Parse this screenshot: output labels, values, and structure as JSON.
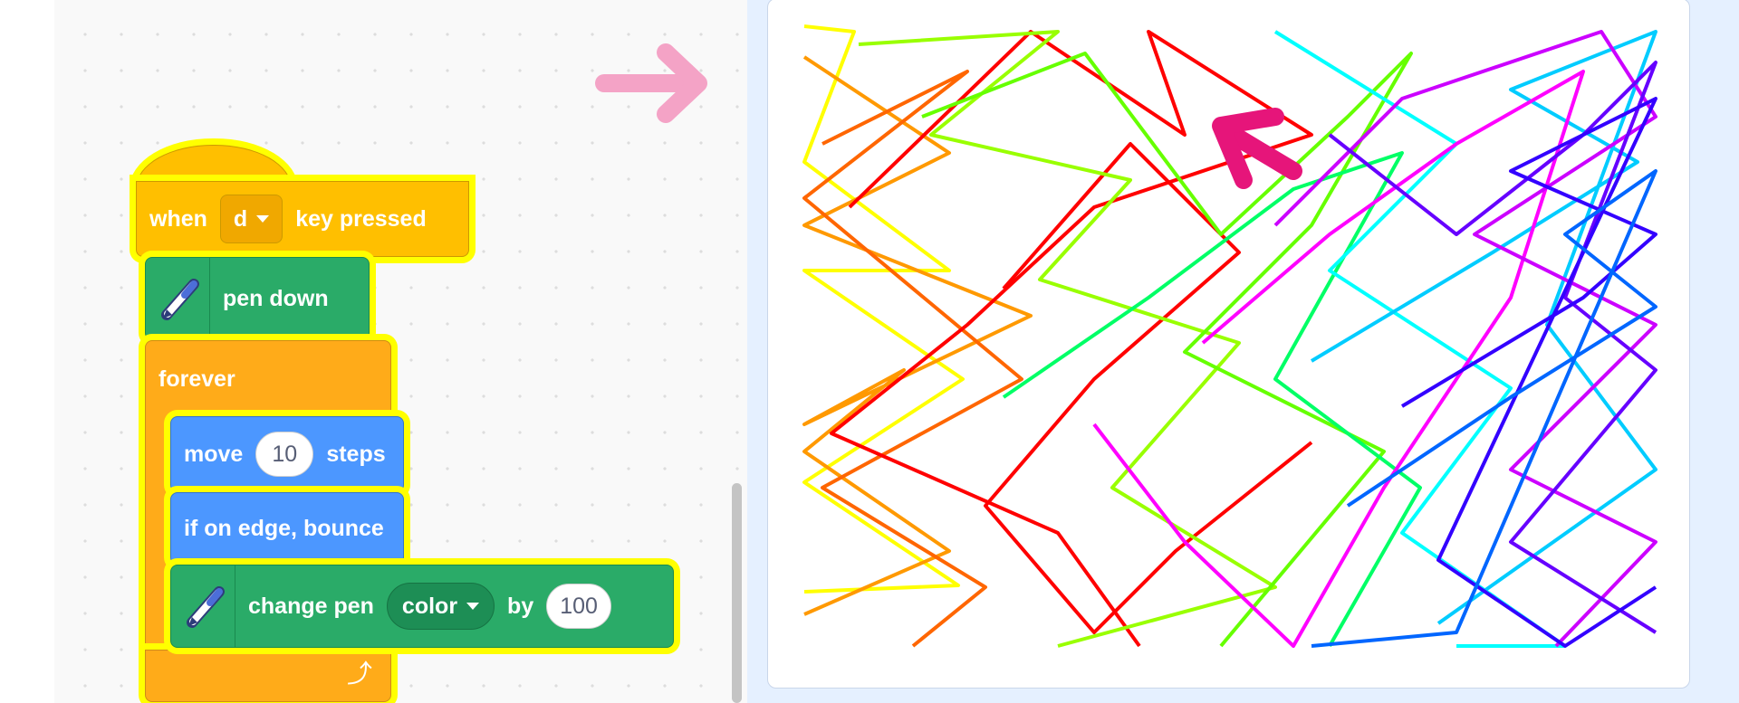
{
  "blocks": {
    "hat": {
      "when": "when",
      "key": "d",
      "rest": "key pressed"
    },
    "pen_down": "pen down",
    "forever": "forever",
    "move": {
      "label": "move",
      "value": "10",
      "unit": "steps"
    },
    "bounce": "if on edge, bounce",
    "change_pen": {
      "label": "change pen",
      "param": "color",
      "by": "by",
      "value": "100"
    }
  },
  "icons": {
    "pen": "pen-icon",
    "loop": "loop-arrow-icon",
    "dropdown": "caret-down-icon",
    "cursor": "cursor-arrow-icon",
    "pointer": "right-arrow-icon"
  },
  "colors": {
    "events": "#ffbf00",
    "pen": "#2aab68",
    "control": "#ffab19",
    "motion": "#4c97ff",
    "highlight": "#ffff00",
    "pointer_arrow": "#f4a3c6",
    "stage_cursor": "#e6157a"
  }
}
